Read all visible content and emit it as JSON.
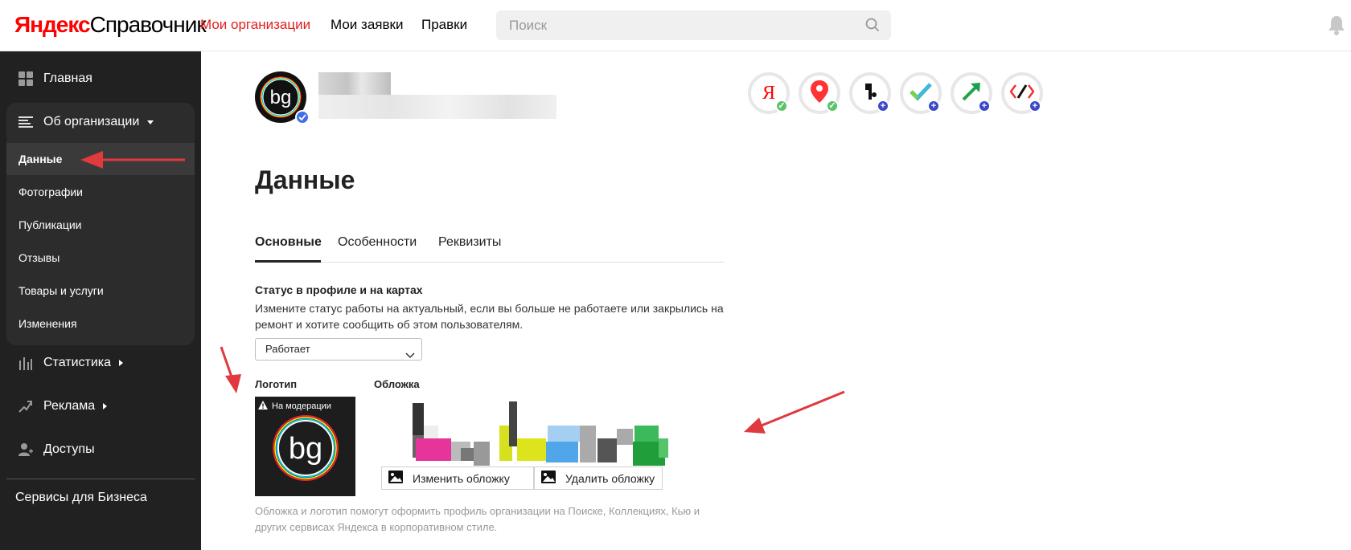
{
  "header": {
    "logo_part1": "Яндекс",
    "logo_part2": "Справочник",
    "nav": [
      {
        "label": "Мои организации",
        "active": true
      },
      {
        "label": "Мои заявки",
        "active": false
      },
      {
        "label": "Правки",
        "active": false
      }
    ],
    "search_placeholder": "Поиск"
  },
  "sidebar": {
    "home": "Главная",
    "about_org": "Об организации",
    "sub_items": [
      "Данные",
      "Фотографии",
      "Публикации",
      "Отзывы",
      "Товары и услуги",
      "Изменения"
    ],
    "active_sub": "Данные",
    "stats": "Статистика",
    "ads": "Реклама",
    "access": "Доступы",
    "business_services": "Сервисы для Бизнеса"
  },
  "org": {
    "avatar_text": "bg",
    "services": [
      {
        "icon": "yandex-icon",
        "status": "connected"
      },
      {
        "icon": "maps-pin-icon",
        "status": "connected"
      },
      {
        "icon": "navigator-icon",
        "status": "add"
      },
      {
        "icon": "check-service-icon",
        "status": "add"
      },
      {
        "icon": "arrow-service-icon",
        "status": "add"
      },
      {
        "icon": "code-tools-icon",
        "status": "add"
      }
    ]
  },
  "main": {
    "title": "Данные",
    "tabs": [
      "Основные",
      "Особенности",
      "Реквизиты"
    ],
    "active_tab": "Основные",
    "status_title": "Статус в профиле и на картах",
    "status_description": "Измените статус работы на актуальный, если вы больше не работаете или закрылись на ремонт и хотите сообщить об этом пользователям.",
    "status_value": "Работает",
    "logo_label": "Логотип",
    "cover_label": "Обложка",
    "moderation_badge": "На модерации",
    "change_cover": "Изменить обложку",
    "delete_cover": "Удалить обложку",
    "hint": "Обложка и логотип помогут оформить профиль организации на Поиске, Коллекциях, Кью и других сервисах Яндекса в корпоративном стиле."
  },
  "colors": {
    "accent_red": "#e01e1e",
    "sidebar_bg": "#212121",
    "annotation_arrow": "#e0393e"
  }
}
